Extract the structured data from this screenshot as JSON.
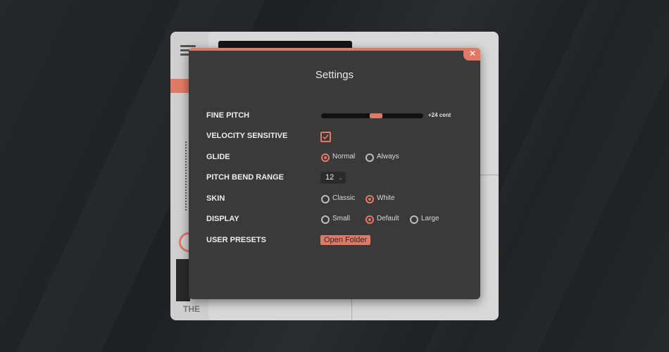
{
  "plugin": {
    "brand_text": "THE"
  },
  "dialog": {
    "title": "Settings",
    "close_glyph": "✕"
  },
  "settings": {
    "fine_pitch": {
      "label": "FINE PITCH",
      "value_text": "+24 cent",
      "value_fraction": 0.6
    },
    "velocity_sensitive": {
      "label": "VELOCITY SENSITIVE",
      "checked": true
    },
    "glide": {
      "label": "GLIDE",
      "options": [
        "Normal",
        "Always"
      ],
      "selected": "Normal"
    },
    "pitch_bend_range": {
      "label": "PITCH BEND RANGE",
      "value": "12"
    },
    "skin": {
      "label": "SKIN",
      "options": [
        "Classic",
        "White"
      ],
      "selected": "White"
    },
    "display": {
      "label": "DISPLAY",
      "options": [
        "Small",
        "Default",
        "Large"
      ],
      "selected": "Default"
    },
    "user_presets": {
      "label": "USER PRESETS",
      "button_label": "Open Folder"
    }
  },
  "icons": {
    "close": "close-icon",
    "menu": "hamburger-icon",
    "checkbox_check": "checkmark-icon",
    "select_chevron": "chevron-down-icon"
  },
  "colors": {
    "accent": "#e07a66",
    "dialog_bg": "#3a3a3a",
    "page_bg": "#222427"
  }
}
